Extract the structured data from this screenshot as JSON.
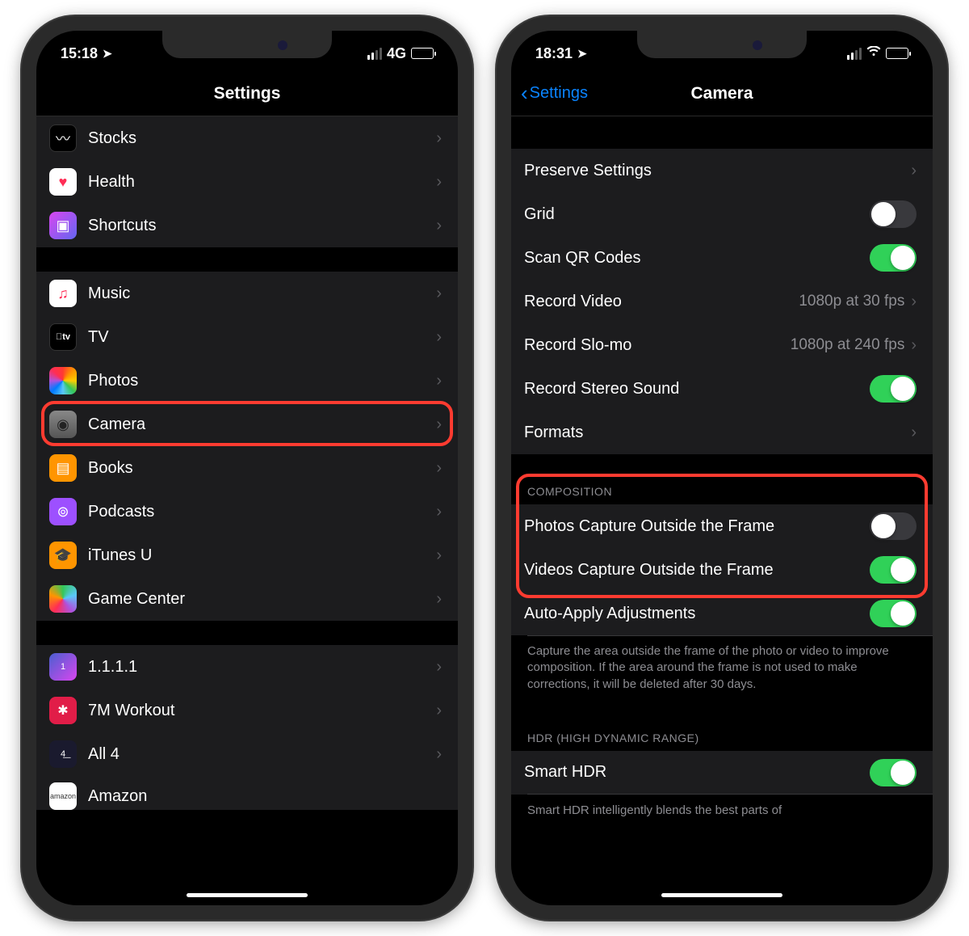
{
  "left": {
    "status": {
      "time": "15:18",
      "network": "4G"
    },
    "title": "Settings",
    "groups": [
      {
        "items": [
          {
            "icon": "stocks",
            "label": "Stocks"
          },
          {
            "icon": "health",
            "label": "Health"
          },
          {
            "icon": "shortcuts",
            "label": "Shortcuts"
          }
        ]
      },
      {
        "items": [
          {
            "icon": "music",
            "label": "Music"
          },
          {
            "icon": "tv",
            "label": "TV"
          },
          {
            "icon": "photos",
            "label": "Photos"
          },
          {
            "icon": "camera",
            "label": "Camera",
            "highlight": true
          },
          {
            "icon": "books",
            "label": "Books"
          },
          {
            "icon": "podcasts",
            "label": "Podcasts"
          },
          {
            "icon": "itunesu",
            "label": "iTunes U"
          },
          {
            "icon": "gamecenter",
            "label": "Game Center"
          }
        ]
      },
      {
        "items": [
          {
            "icon": "1111",
            "label": "1.1.1.1"
          },
          {
            "icon": "7m",
            "label": "7M Workout"
          },
          {
            "icon": "all4",
            "label": "All 4"
          },
          {
            "icon": "amazon",
            "label": "Amazon"
          }
        ]
      }
    ]
  },
  "right": {
    "status": {
      "time": "18:31"
    },
    "back": "Settings",
    "title": "Camera",
    "sections": {
      "main": [
        {
          "label": "Preserve Settings",
          "type": "disclosure"
        },
        {
          "label": "Grid",
          "type": "toggle",
          "on": false
        },
        {
          "label": "Scan QR Codes",
          "type": "toggle",
          "on": true
        },
        {
          "label": "Record Video",
          "type": "detail",
          "detail": "1080p at 30 fps"
        },
        {
          "label": "Record Slo-mo",
          "type": "detail",
          "detail": "1080p at 240 fps"
        },
        {
          "label": "Record Stereo Sound",
          "type": "toggle",
          "on": true
        },
        {
          "label": "Formats",
          "type": "disclosure"
        }
      ],
      "composition": {
        "header": "COMPOSITION",
        "items": [
          {
            "label": "Photos Capture Outside the Frame",
            "type": "toggle",
            "on": false
          },
          {
            "label": "Videos Capture Outside the Frame",
            "type": "toggle",
            "on": true
          },
          {
            "label": "Auto-Apply Adjustments",
            "type": "toggle",
            "on": true
          }
        ],
        "footer": "Capture the area outside the frame of the photo or video to improve composition. If the area around the frame is not used to make corrections, it will be deleted after 30 days."
      },
      "hdr": {
        "header": "HDR (HIGH DYNAMIC RANGE)",
        "items": [
          {
            "label": "Smart HDR",
            "type": "toggle",
            "on": true
          }
        ],
        "footer": "Smart HDR intelligently blends the best parts of"
      }
    }
  },
  "iconGlyphs": {
    "stocks": "〰",
    "health": "♥",
    "shortcuts": "▣",
    "music": "♫",
    "tv": "tv",
    "photos": "✿",
    "camera": "◉",
    "books": "▤",
    "podcasts": "⊚",
    "itunesu": "🎓",
    "gamecenter": "◑",
    "1111": "1",
    "7m": "✱",
    "all4": "4͟",
    "amazon": "amazon"
  }
}
